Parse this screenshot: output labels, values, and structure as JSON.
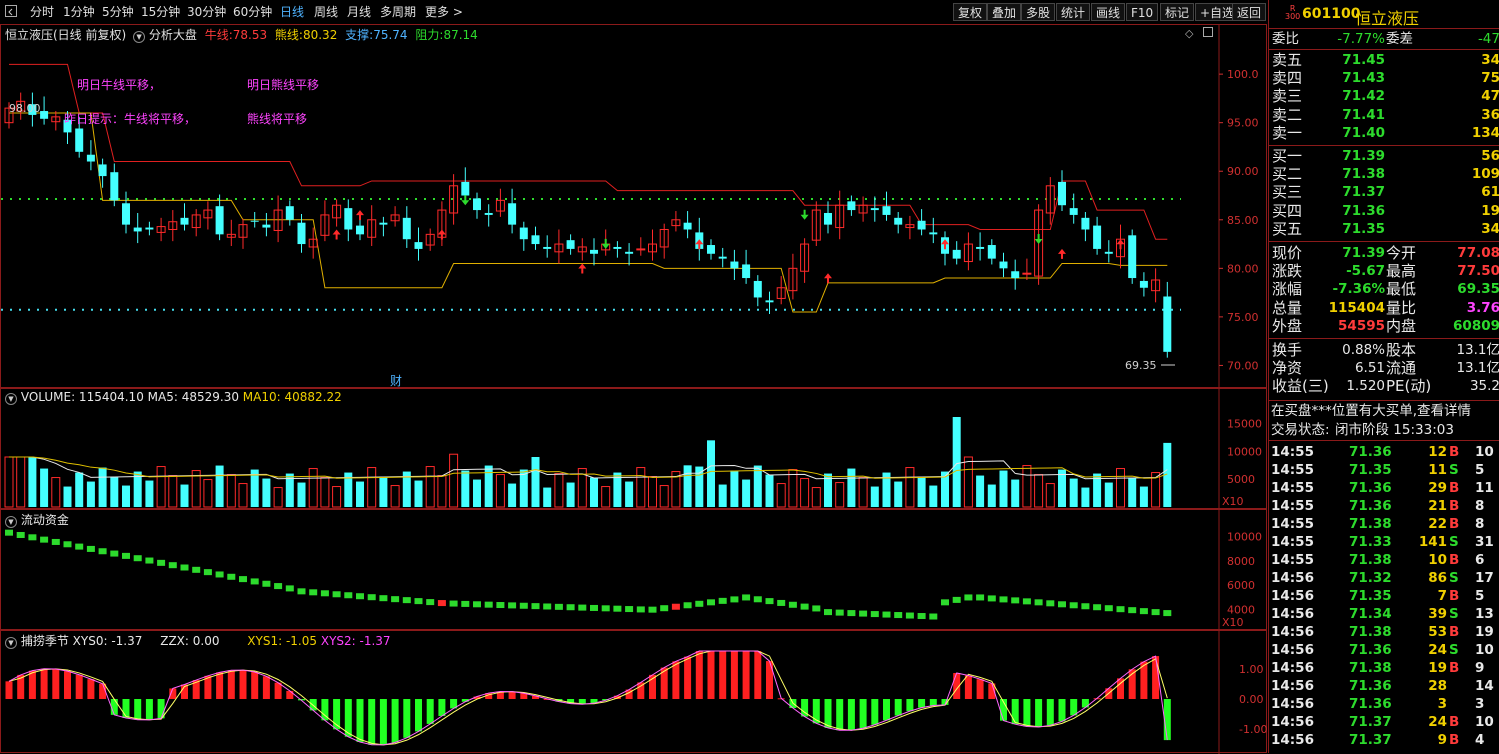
{
  "toolbar": {
    "periods": [
      "分时",
      "1分钟",
      "5分钟",
      "15分钟",
      "30分钟",
      "60分钟",
      "日线",
      "周线",
      "月线",
      "多周期",
      "更多"
    ],
    "active_period": "日线",
    "buttons": [
      "复权",
      "叠加",
      "多股",
      "统计",
      "画线",
      "F10",
      "标记",
      "+自选",
      "返回"
    ]
  },
  "main_chart": {
    "header_stock": "恒立液压(日线 前复权)",
    "header_indicator": "分析大盘",
    "bull_label": "牛线:",
    "bull_value": "78.53",
    "bear_label": "熊线:",
    "bear_value": "80.32",
    "support_label": "支撑:",
    "support_value": "75.74",
    "resist_label": "阻力:",
    "resist_value": "87.14",
    "annotations": {
      "tomorrow_bull": "明日牛线平移，",
      "tomorrow_bear": "明日熊线平移",
      "yesterday_tip": "昨日提示：牛线将平移，",
      "bear_flat": "熊线将平移",
      "high_marker": "98.00",
      "low_marker": "69.35",
      "finance_marker": "财"
    },
    "y_ticks": [
      "100.0",
      "95.00",
      "90.00",
      "85.00",
      "80.00",
      "75.00",
      "70.00"
    ]
  },
  "volume_panel": {
    "title": "VOLUME: 115404.10",
    "ma5": "MA5: 48529.30",
    "ma10": "MA10: 40882.22",
    "y_ticks": [
      "15000",
      "10000",
      "5000"
    ],
    "unit": "X10"
  },
  "flow_panel": {
    "title": "流动资金",
    "y_ticks": [
      "10000",
      "8000",
      "6000",
      "4000"
    ],
    "unit": "X10"
  },
  "season_panel": {
    "title": "捕捞季节",
    "xys0": "XYS0: -1.37",
    "zzx": "ZZX: 0.00",
    "xys1": "XYS1: -1.05",
    "xys2": "XYS2: -1.37",
    "y_ticks": [
      "1.00",
      "0.00",
      "-1.00"
    ]
  },
  "quote": {
    "badge": "R\n300",
    "code": "601100",
    "name": "恒立液压",
    "weibi_label": "委比",
    "weibi": "-7.77%",
    "weicha_label": "委差",
    "weicha": "-47",
    "sells": [
      {
        "label": "卖五",
        "price": "71.45",
        "vol": "34"
      },
      {
        "label": "卖四",
        "price": "71.43",
        "vol": "75"
      },
      {
        "label": "卖三",
        "price": "71.42",
        "vol": "47"
      },
      {
        "label": "卖二",
        "price": "71.41",
        "vol": "36"
      },
      {
        "label": "卖一",
        "price": "71.40",
        "vol": "134"
      }
    ],
    "buys": [
      {
        "label": "买一",
        "price": "71.39",
        "vol": "56"
      },
      {
        "label": "买二",
        "price": "71.38",
        "vol": "109"
      },
      {
        "label": "买三",
        "price": "71.37",
        "vol": "61"
      },
      {
        "label": "买四",
        "price": "71.36",
        "vol": "19"
      },
      {
        "label": "买五",
        "price": "71.35",
        "vol": "34"
      }
    ],
    "stats": [
      {
        "l1": "现价",
        "v1": "71.39",
        "l2": "今开",
        "v2": "77.08",
        "c1": "green",
        "c2": "red"
      },
      {
        "l1": "涨跌",
        "v1": "-5.67",
        "l2": "最高",
        "v2": "77.50",
        "c1": "green",
        "c2": "red"
      },
      {
        "l1": "涨幅",
        "v1": "-7.36%",
        "l2": "最低",
        "v2": "69.35",
        "c1": "green",
        "c2": "green"
      },
      {
        "l1": "总量",
        "v1": "115404",
        "l2": "量比",
        "v2": "3.76",
        "c1": "yel",
        "c2": "mag"
      },
      {
        "l1": "外盘",
        "v1": "54595",
        "l2": "内盘",
        "v2": "60809",
        "c1": "red",
        "c2": "green"
      }
    ],
    "stats2": [
      {
        "l1": "换手",
        "v1": "0.88%",
        "l2": "股本",
        "v2": "13.1亿"
      },
      {
        "l1": "净资",
        "v1": "6.51",
        "l2": "流通",
        "v2": "13.1亿"
      },
      {
        "l1": "收益(三)",
        "v1": "1.520",
        "l2": "PE(动)",
        "v2": "35.2"
      }
    ],
    "notice": "在买盘***位置有大买单,查看详情",
    "status_label": "交易状态:",
    "status_value": "闭市阶段 15:33:03",
    "ticks": [
      {
        "t": "14:55",
        "p": "71.36",
        "v": "12",
        "d": "B",
        "n": "10"
      },
      {
        "t": "14:55",
        "p": "71.35",
        "v": "11",
        "d": "S",
        "n": "5"
      },
      {
        "t": "14:55",
        "p": "71.36",
        "v": "29",
        "d": "B",
        "n": "11"
      },
      {
        "t": "14:55",
        "p": "71.36",
        "v": "21",
        "d": "B",
        "n": "8"
      },
      {
        "t": "14:55",
        "p": "71.38",
        "v": "22",
        "d": "B",
        "n": "8"
      },
      {
        "t": "14:55",
        "p": "71.33",
        "v": "141",
        "d": "S",
        "n": "31"
      },
      {
        "t": "14:55",
        "p": "71.38",
        "v": "10",
        "d": "B",
        "n": "6"
      },
      {
        "t": "14:56",
        "p": "71.32",
        "v": "86",
        "d": "S",
        "n": "17"
      },
      {
        "t": "14:56",
        "p": "71.35",
        "v": "7",
        "d": "B",
        "n": "5"
      },
      {
        "t": "14:56",
        "p": "71.34",
        "v": "39",
        "d": "S",
        "n": "13"
      },
      {
        "t": "14:56",
        "p": "71.38",
        "v": "53",
        "d": "B",
        "n": "19"
      },
      {
        "t": "14:56",
        "p": "71.36",
        "v": "24",
        "d": "S",
        "n": "10"
      },
      {
        "t": "14:56",
        "p": "71.38",
        "v": "19",
        "d": "B",
        "n": "9"
      },
      {
        "t": "14:56",
        "p": "71.36",
        "v": "28",
        "d": "",
        "n": "14"
      },
      {
        "t": "14:56",
        "p": "71.36",
        "v": "3",
        "d": "",
        "n": "3"
      },
      {
        "t": "14:56",
        "p": "71.37",
        "v": "24",
        "d": "B",
        "n": "10"
      },
      {
        "t": "14:56",
        "p": "71.37",
        "v": "9",
        "d": "B",
        "n": "4"
      }
    ]
  },
  "colors": {
    "up": "#ff2a2a",
    "down": "#44ffff",
    "bg": "#000000",
    "frame": "#8b1a1a"
  }
}
